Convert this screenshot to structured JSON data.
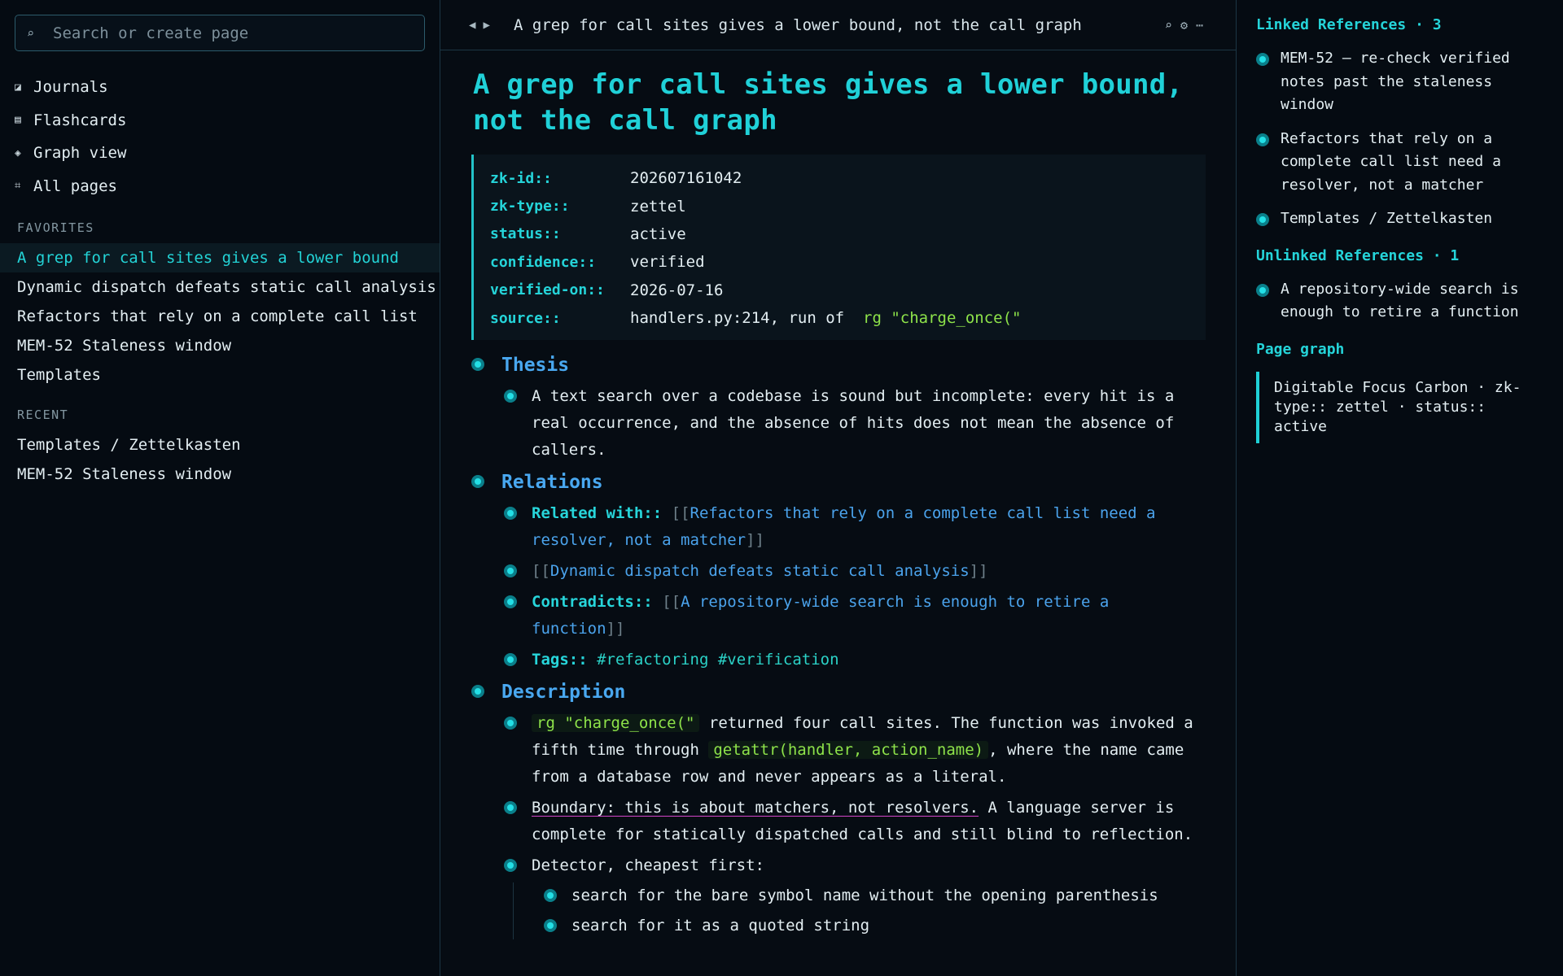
{
  "sidebar": {
    "search_placeholder": "Search or create page",
    "nav": [
      {
        "icon": "journal-icon",
        "label": "Journals"
      },
      {
        "icon": "flashcards-icon",
        "label": "Flashcards"
      },
      {
        "icon": "graph-icon",
        "label": "Graph view"
      },
      {
        "icon": "pages-icon",
        "label": "All pages"
      }
    ],
    "favorites_label": "FAVORITES",
    "favorites": [
      "A grep for call sites gives a lower bound",
      "Dynamic dispatch defeats static call analysis",
      "Refactors that rely on a complete call list",
      "MEM-52 Staleness window",
      "Templates"
    ],
    "recent_label": "RECENT",
    "recent": [
      "Templates / Zettelkasten",
      "MEM-52 Staleness window"
    ]
  },
  "topbar": {
    "back_glyph": "◀",
    "forward_glyph": "▶",
    "title": "A grep for call sites gives a lower bound, not the call graph",
    "search_glyph": "⌕",
    "settings_glyph": "⚙",
    "more_glyph": "⋯"
  },
  "page": {
    "title": "A grep for call sites gives a lower bound, not the call graph",
    "properties": [
      {
        "key": "zk-id",
        "value": "202607161042"
      },
      {
        "key": "zk-type",
        "value": "zettel"
      },
      {
        "key": "status",
        "value": "active"
      },
      {
        "key": "confidence",
        "value": "verified"
      },
      {
        "key": "verified-on",
        "value": "2026-07-16"
      },
      {
        "key": "source",
        "value": "handlers.py:214, run of",
        "code": "rg \"charge_once(\""
      }
    ],
    "thesis": {
      "heading": "Thesis",
      "text": "A text search over a codebase is sound but incomplete: every hit is a real occurrence, and the absence of hits does not mean the absence of callers."
    },
    "relations": {
      "heading": "Relations",
      "related_key": "Related with",
      "related_link": "Refactors that rely on a complete call list need a resolver, not a matcher",
      "related_link2": "Dynamic dispatch defeats static call analysis",
      "contradicts_key": "Contradicts",
      "contradicts_link": "A repository-wide search is enough to retire a function",
      "tags_key": "Tags",
      "tags": "#refactoring #verification"
    },
    "description": {
      "heading": "Description",
      "p1_code": "rg \"charge_once(\"",
      "p1_a": " returned four call sites. The function was invoked a fifth time through ",
      "p1_code2": "getattr(handler, action_name)",
      "p1_b": ", where the name came from a database row and never appears as a literal.",
      "p2_underlined": "Boundary: this is about matchers, not resolvers.",
      "p2_rest": " A language server is complete for statically dispatched calls and still blind to reflection.",
      "p3": "Detector, cheapest first:",
      "sub": [
        "search for the bare symbol name without the opening parenthesis",
        "search for it as a quoted string"
      ]
    }
  },
  "right": {
    "linked_heading": "Linked References · 3",
    "linked": [
      "MEM-52 — re-check verified notes past the staleness window",
      "Refactors that rely on a complete call list need a resolver, not a matcher",
      "Templates / Zettelkasten"
    ],
    "unlinked_heading": "Unlinked References · 1",
    "unlinked": [
      "A repository-wide search is enough to retire a function"
    ],
    "graph_heading": "Page graph",
    "graph_text": "Digitable Focus Carbon · zk-type:: zettel · status:: active"
  },
  "colors": {
    "accent": "#20d1d8",
    "heading_blue": "#49a8f0",
    "code_green": "#8ee34a",
    "background": "#060c13"
  }
}
